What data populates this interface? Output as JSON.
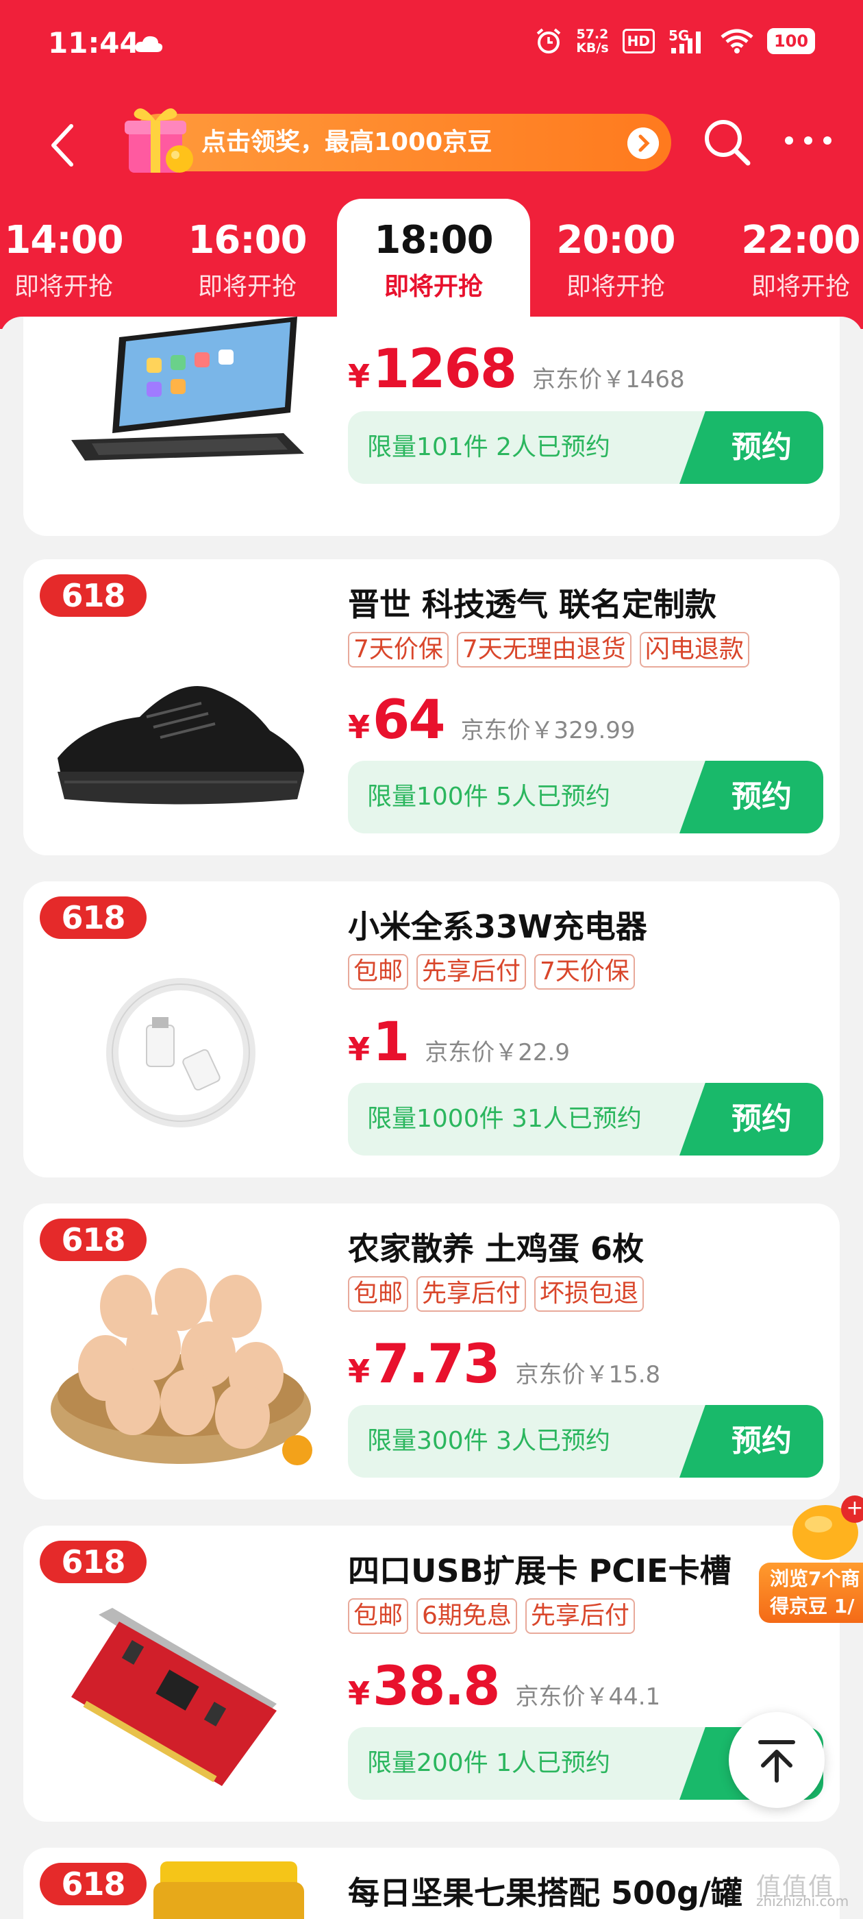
{
  "status_bar": {
    "time": "11:44",
    "net_speed_value": "57.2",
    "net_speed_unit": "KB/s",
    "hd": "HD",
    "network": "5G",
    "battery": "100"
  },
  "nav": {
    "promo_text": "点击领奖，最高1000京豆"
  },
  "time_tabs": [
    {
      "time": "14:00",
      "status": "即将开抢",
      "active": false
    },
    {
      "time": "16:00",
      "status": "即将开抢",
      "active": false
    },
    {
      "time": "18:00",
      "status": "即将开抢",
      "active": true
    },
    {
      "time": "20:00",
      "status": "即将开抢",
      "active": false
    },
    {
      "time": "22:00",
      "status": "即将开抢",
      "active": false
    }
  ],
  "products": [
    {
      "badge": "",
      "title": "",
      "tags": [],
      "price_symbol": "¥",
      "price": "1268",
      "jd_price": "京东价￥1468",
      "limit_info": "限量101件 2人已预约",
      "button": "预约",
      "icon": "tablet-keyboard"
    },
    {
      "badge": "618",
      "title": "晋世 科技透气 联名定制款",
      "tags": [
        "7天价保",
        "7天无理由退货",
        "闪电退款"
      ],
      "price_symbol": "¥",
      "price": "64",
      "jd_price": "京东价￥329.99",
      "limit_info": "限量100件 5人已预约",
      "button": "预约",
      "icon": "sneaker"
    },
    {
      "badge": "618",
      "title": "小米全系33W充电器",
      "tags": [
        "包邮",
        "先享后付",
        "7天价保"
      ],
      "price_symbol": "¥",
      "price": "1",
      "jd_price": "京东价￥22.9",
      "limit_info": "限量1000件 31人已预约",
      "button": "预约",
      "icon": "usb-cable"
    },
    {
      "badge": "618",
      "title": "农家散养 土鸡蛋 6枚",
      "tags": [
        "包邮",
        "先享后付",
        "坏损包退"
      ],
      "price_symbol": "¥",
      "price": "7.73",
      "jd_price": "京东价￥15.8",
      "limit_info": "限量300件 3人已预约",
      "button": "预约",
      "icon": "eggs-basket"
    },
    {
      "badge": "618",
      "title": "四口USB扩展卡 PCIE卡槽",
      "tags": [
        "包邮",
        "6期免息",
        "先享后付"
      ],
      "price_symbol": "¥",
      "price": "38.8",
      "jd_price": "京东价￥44.1",
      "limit_info": "限量200件 1人已预约",
      "button": "预约",
      "icon": "pcie-card"
    },
    {
      "badge": "618",
      "title": "每日坚果七果搭配 500g/罐",
      "tags": [],
      "price_symbol": "",
      "price": "",
      "jd_price": "",
      "limit_info": "",
      "button": "",
      "icon": "nut-jar"
    }
  ],
  "floating": {
    "browse_line1": "浏览7个商",
    "browse_line2": "得京豆 1/",
    "plus": "+"
  },
  "watermark": {
    "glyphs": "值值值",
    "url": "zhizhizhi.com"
  },
  "colors": {
    "header_red": "#f0203a",
    "price_red": "#e8112d",
    "reserve_green": "#19b96a",
    "badge_red": "#e52a2a"
  }
}
